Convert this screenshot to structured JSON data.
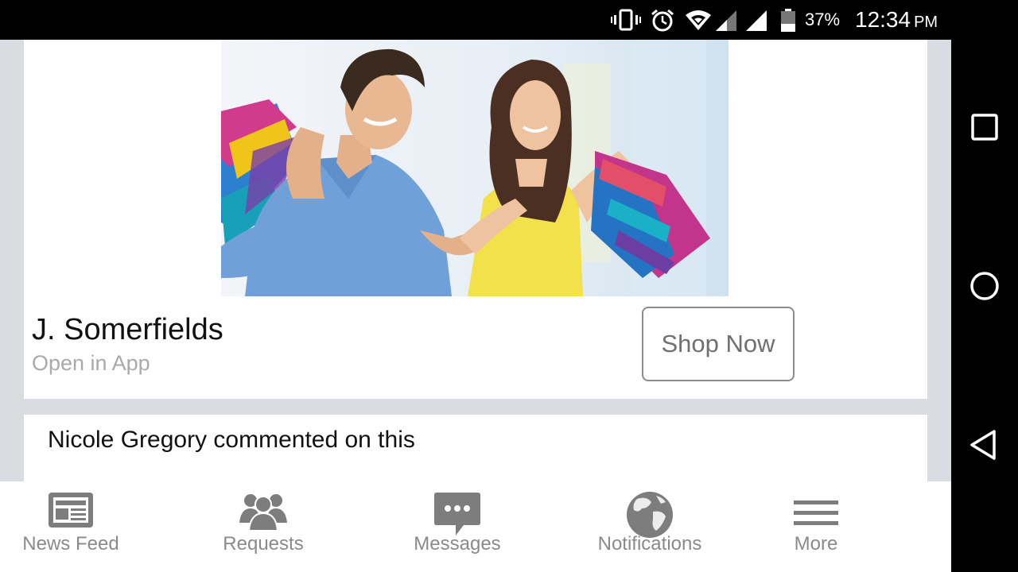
{
  "status_bar": {
    "battery_percent": "37%",
    "time": "12:34",
    "ampm": "PM",
    "icons": [
      "vibrate-icon",
      "alarm-icon",
      "wifi-icon",
      "cell-signal-icon",
      "cell-signal-icon",
      "battery-icon"
    ]
  },
  "ad": {
    "image": "shopping-couple-photo",
    "title": "J. Somerfields",
    "subtitle": "Open in App",
    "cta_label": "Shop Now"
  },
  "comment": {
    "text": "Nicole Gregory commented on this"
  },
  "tabs": [
    {
      "label": "News Feed",
      "icon": "news-feed-icon"
    },
    {
      "label": "Requests",
      "icon": "requests-icon"
    },
    {
      "label": "Messages",
      "icon": "messages-icon"
    },
    {
      "label": "Notifications",
      "icon": "globe-icon"
    },
    {
      "label": "More",
      "icon": "menu-icon"
    }
  ],
  "nav_bar": {
    "buttons": [
      "recents-icon",
      "home-icon",
      "back-icon"
    ]
  },
  "colors": {
    "feed_background": "#d9dce1",
    "tab_label": "#8a8a8a",
    "tab_icon": "#7d7d7d",
    "subtitle": "#aaaaaa"
  }
}
